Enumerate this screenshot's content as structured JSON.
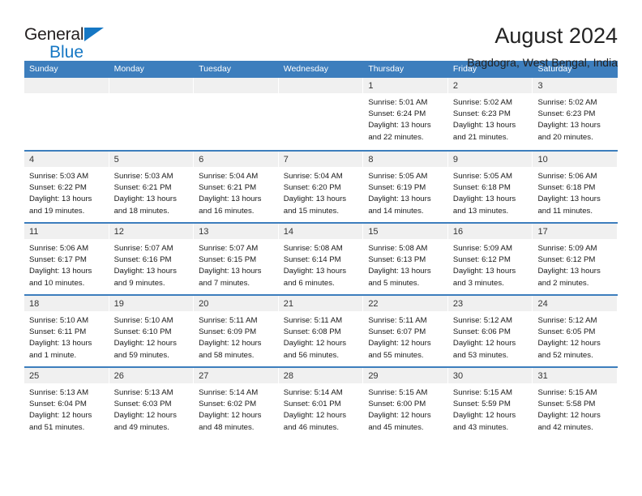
{
  "brand": {
    "name_top": "General",
    "name_bottom": "Blue",
    "triangle_icon": "triangle-icon",
    "color_dark": "#231f20",
    "color_blue": "#1577c4"
  },
  "header": {
    "title": "August 2024",
    "subtitle": "Bagdogra, West Bengal, India"
  },
  "theme": {
    "header_blue": "#3d7ebd",
    "daynum_band": "#f0f0f0",
    "text": "#1a1a1a"
  },
  "calendar": {
    "weekday_headers": [
      "Sunday",
      "Monday",
      "Tuesday",
      "Wednesday",
      "Thursday",
      "Friday",
      "Saturday"
    ],
    "weeks": [
      [
        {
          "day": "",
          "lines": []
        },
        {
          "day": "",
          "lines": []
        },
        {
          "day": "",
          "lines": []
        },
        {
          "day": "",
          "lines": []
        },
        {
          "day": "1",
          "lines": [
            "Sunrise: 5:01 AM",
            "Sunset: 6:24 PM",
            "Daylight: 13 hours",
            "and 22 minutes."
          ]
        },
        {
          "day": "2",
          "lines": [
            "Sunrise: 5:02 AM",
            "Sunset: 6:23 PM",
            "Daylight: 13 hours",
            "and 21 minutes."
          ]
        },
        {
          "day": "3",
          "lines": [
            "Sunrise: 5:02 AM",
            "Sunset: 6:23 PM",
            "Daylight: 13 hours",
            "and 20 minutes."
          ]
        }
      ],
      [
        {
          "day": "4",
          "lines": [
            "Sunrise: 5:03 AM",
            "Sunset: 6:22 PM",
            "Daylight: 13 hours",
            "and 19 minutes."
          ]
        },
        {
          "day": "5",
          "lines": [
            "Sunrise: 5:03 AM",
            "Sunset: 6:21 PM",
            "Daylight: 13 hours",
            "and 18 minutes."
          ]
        },
        {
          "day": "6",
          "lines": [
            "Sunrise: 5:04 AM",
            "Sunset: 6:21 PM",
            "Daylight: 13 hours",
            "and 16 minutes."
          ]
        },
        {
          "day": "7",
          "lines": [
            "Sunrise: 5:04 AM",
            "Sunset: 6:20 PM",
            "Daylight: 13 hours",
            "and 15 minutes."
          ]
        },
        {
          "day": "8",
          "lines": [
            "Sunrise: 5:05 AM",
            "Sunset: 6:19 PM",
            "Daylight: 13 hours",
            "and 14 minutes."
          ]
        },
        {
          "day": "9",
          "lines": [
            "Sunrise: 5:05 AM",
            "Sunset: 6:18 PM",
            "Daylight: 13 hours",
            "and 13 minutes."
          ]
        },
        {
          "day": "10",
          "lines": [
            "Sunrise: 5:06 AM",
            "Sunset: 6:18 PM",
            "Daylight: 13 hours",
            "and 11 minutes."
          ]
        }
      ],
      [
        {
          "day": "11",
          "lines": [
            "Sunrise: 5:06 AM",
            "Sunset: 6:17 PM",
            "Daylight: 13 hours",
            "and 10 minutes."
          ]
        },
        {
          "day": "12",
          "lines": [
            "Sunrise: 5:07 AM",
            "Sunset: 6:16 PM",
            "Daylight: 13 hours",
            "and 9 minutes."
          ]
        },
        {
          "day": "13",
          "lines": [
            "Sunrise: 5:07 AM",
            "Sunset: 6:15 PM",
            "Daylight: 13 hours",
            "and 7 minutes."
          ]
        },
        {
          "day": "14",
          "lines": [
            "Sunrise: 5:08 AM",
            "Sunset: 6:14 PM",
            "Daylight: 13 hours",
            "and 6 minutes."
          ]
        },
        {
          "day": "15",
          "lines": [
            "Sunrise: 5:08 AM",
            "Sunset: 6:13 PM",
            "Daylight: 13 hours",
            "and 5 minutes."
          ]
        },
        {
          "day": "16",
          "lines": [
            "Sunrise: 5:09 AM",
            "Sunset: 6:12 PM",
            "Daylight: 13 hours",
            "and 3 minutes."
          ]
        },
        {
          "day": "17",
          "lines": [
            "Sunrise: 5:09 AM",
            "Sunset: 6:12 PM",
            "Daylight: 13 hours",
            "and 2 minutes."
          ]
        }
      ],
      [
        {
          "day": "18",
          "lines": [
            "Sunrise: 5:10 AM",
            "Sunset: 6:11 PM",
            "Daylight: 13 hours",
            "and 1 minute."
          ]
        },
        {
          "day": "19",
          "lines": [
            "Sunrise: 5:10 AM",
            "Sunset: 6:10 PM",
            "Daylight: 12 hours",
            "and 59 minutes."
          ]
        },
        {
          "day": "20",
          "lines": [
            "Sunrise: 5:11 AM",
            "Sunset: 6:09 PM",
            "Daylight: 12 hours",
            "and 58 minutes."
          ]
        },
        {
          "day": "21",
          "lines": [
            "Sunrise: 5:11 AM",
            "Sunset: 6:08 PM",
            "Daylight: 12 hours",
            "and 56 minutes."
          ]
        },
        {
          "day": "22",
          "lines": [
            "Sunrise: 5:11 AM",
            "Sunset: 6:07 PM",
            "Daylight: 12 hours",
            "and 55 minutes."
          ]
        },
        {
          "day": "23",
          "lines": [
            "Sunrise: 5:12 AM",
            "Sunset: 6:06 PM",
            "Daylight: 12 hours",
            "and 53 minutes."
          ]
        },
        {
          "day": "24",
          "lines": [
            "Sunrise: 5:12 AM",
            "Sunset: 6:05 PM",
            "Daylight: 12 hours",
            "and 52 minutes."
          ]
        }
      ],
      [
        {
          "day": "25",
          "lines": [
            "Sunrise: 5:13 AM",
            "Sunset: 6:04 PM",
            "Daylight: 12 hours",
            "and 51 minutes."
          ]
        },
        {
          "day": "26",
          "lines": [
            "Sunrise: 5:13 AM",
            "Sunset: 6:03 PM",
            "Daylight: 12 hours",
            "and 49 minutes."
          ]
        },
        {
          "day": "27",
          "lines": [
            "Sunrise: 5:14 AM",
            "Sunset: 6:02 PM",
            "Daylight: 12 hours",
            "and 48 minutes."
          ]
        },
        {
          "day": "28",
          "lines": [
            "Sunrise: 5:14 AM",
            "Sunset: 6:01 PM",
            "Daylight: 12 hours",
            "and 46 minutes."
          ]
        },
        {
          "day": "29",
          "lines": [
            "Sunrise: 5:15 AM",
            "Sunset: 6:00 PM",
            "Daylight: 12 hours",
            "and 45 minutes."
          ]
        },
        {
          "day": "30",
          "lines": [
            "Sunrise: 5:15 AM",
            "Sunset: 5:59 PM",
            "Daylight: 12 hours",
            "and 43 minutes."
          ]
        },
        {
          "day": "31",
          "lines": [
            "Sunrise: 5:15 AM",
            "Sunset: 5:58 PM",
            "Daylight: 12 hours",
            "and 42 minutes."
          ]
        }
      ]
    ]
  }
}
